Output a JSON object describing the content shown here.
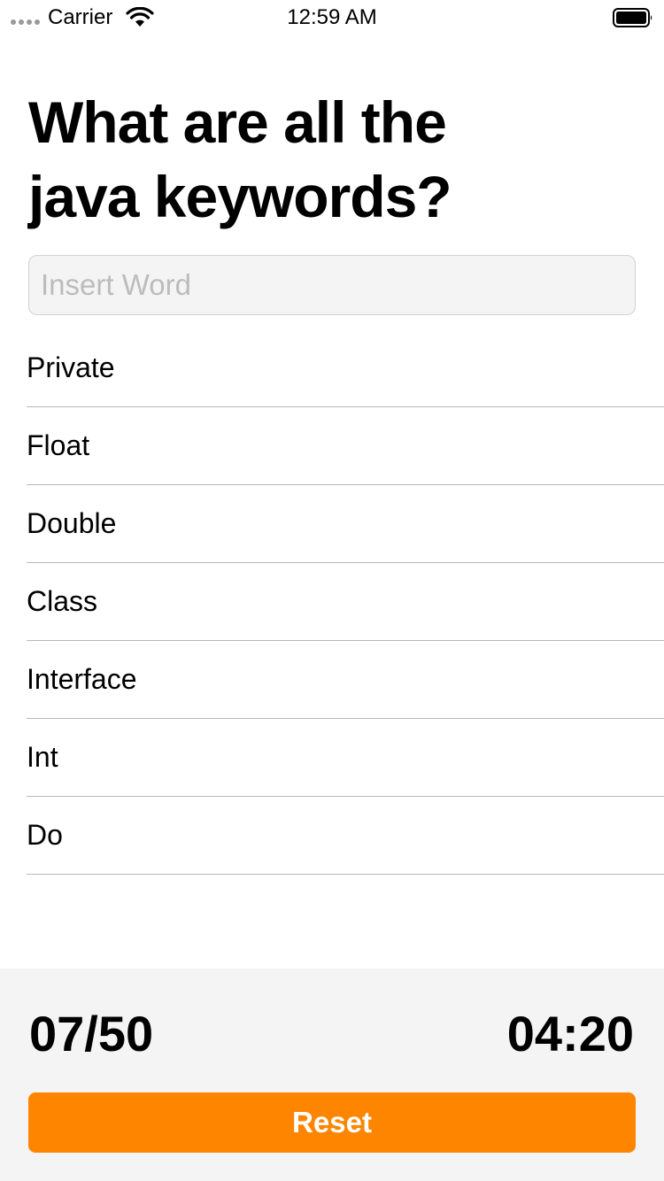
{
  "status_bar": {
    "carrier": "Carrier",
    "time": "12:59 AM",
    "wifi_icon": "wifi-icon",
    "battery_icon": "battery-full-icon"
  },
  "question": {
    "line1": "What are all the",
    "line2": "java keywords?"
  },
  "input": {
    "value": "",
    "placeholder": "Insert Word"
  },
  "words": [
    "Private",
    "Float",
    "Double",
    "Class",
    "Interface",
    "Int",
    "Do"
  ],
  "footer": {
    "score": "07/50",
    "timer": "04:20",
    "reset_label": "Reset"
  },
  "colors": {
    "accent": "#fe8500",
    "panel_background": "#f4f4f4",
    "input_background": "#f4f4f4",
    "placeholder": "#bcbcbc",
    "separator": "#b8b8b8"
  }
}
